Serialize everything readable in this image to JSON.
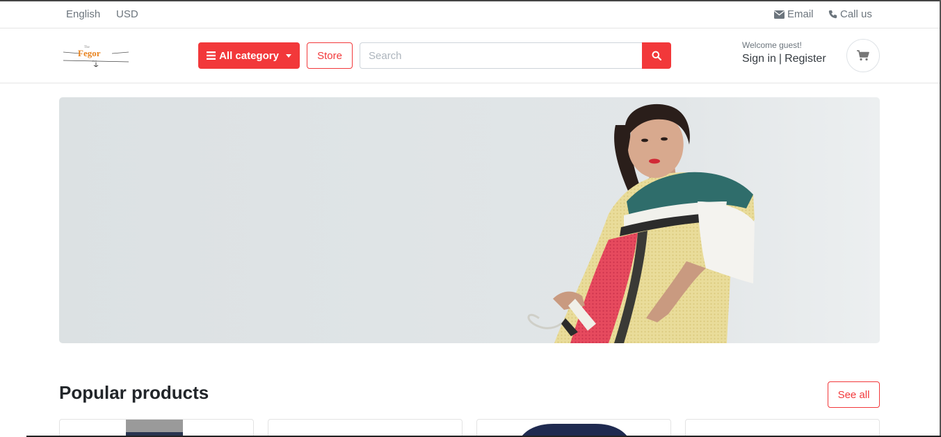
{
  "topbar": {
    "language": "English",
    "currency": "USD",
    "email_label": "Email",
    "call_label": "Call us"
  },
  "header": {
    "logo_text": "Fegor",
    "category_button": "All category",
    "store_button": "Store",
    "search": {
      "placeholder": "Search",
      "value": ""
    },
    "welcome_text": "Welcome guest!",
    "sign_in": "Sign in",
    "separator": "|",
    "register": "Register"
  },
  "hero": {
    "image": "fashion-model-banner"
  },
  "popular": {
    "title": "Popular products",
    "see_all": "See all"
  },
  "colors": {
    "accent": "#f2383a",
    "muted_text": "#6c757d",
    "hero_bg": "#dde2e4"
  },
  "icons": [
    "envelope-icon",
    "phone-icon",
    "bars-icon",
    "caret-down-icon",
    "search-icon",
    "cart-icon"
  ]
}
